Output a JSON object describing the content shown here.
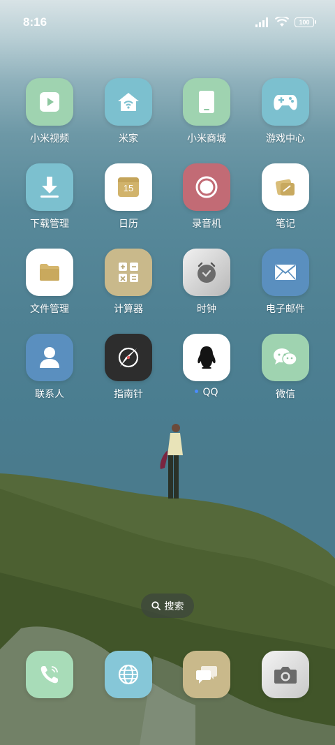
{
  "status": {
    "time": "8:16",
    "battery": "100"
  },
  "apps": [
    {
      "label": "小米视频",
      "icon": "play-icon",
      "bg": "#9fd3b0"
    },
    {
      "label": "米家",
      "icon": "home-wifi-icon",
      "bg": "#7cc0cf"
    },
    {
      "label": "小米商城",
      "icon": "tablet-icon",
      "bg": "#9fd3b0"
    },
    {
      "label": "游戏中心",
      "icon": "gamepad-icon",
      "bg": "#7cc0cf"
    },
    {
      "label": "下载管理",
      "icon": "download-icon",
      "bg": "#7cc0cf"
    },
    {
      "label": "日历",
      "icon": "calendar-icon",
      "bg": "#ffffff",
      "day": "15"
    },
    {
      "label": "录音机",
      "icon": "record-icon",
      "bg": "#c26b75"
    },
    {
      "label": "笔记",
      "icon": "notes-icon",
      "bg": "#ffffff"
    },
    {
      "label": "文件管理",
      "icon": "folder-icon",
      "bg": "#ffffff"
    },
    {
      "label": "计算器",
      "icon": "calculator-icon",
      "bg": "#c9b98b"
    },
    {
      "label": "时钟",
      "icon": "clock-icon",
      "bg": "#d9d9d9"
    },
    {
      "label": "电子邮件",
      "icon": "mail-icon",
      "bg": "#5a8fbf"
    },
    {
      "label": "联系人",
      "icon": "contact-icon",
      "bg": "#5a8fbf"
    },
    {
      "label": "指南针",
      "icon": "compass-icon",
      "bg": "#2d2d2d"
    },
    {
      "label": "QQ",
      "icon": "qq-penguin-icon",
      "bg": "#ffffff"
    },
    {
      "label": "微信",
      "icon": "wechat-icon",
      "bg": "#9fd3b0"
    }
  ],
  "search": {
    "label": "搜索"
  },
  "dock": [
    {
      "name": "phone",
      "icon": "phone-icon",
      "bg": "#a8dcb8"
    },
    {
      "name": "browser",
      "icon": "globe-icon",
      "bg": "#86c7d8"
    },
    {
      "name": "messages",
      "icon": "chat-icon",
      "bg": "#c9b98b"
    },
    {
      "name": "camera",
      "icon": "camera-icon",
      "bg": "#e2e2e2"
    }
  ]
}
